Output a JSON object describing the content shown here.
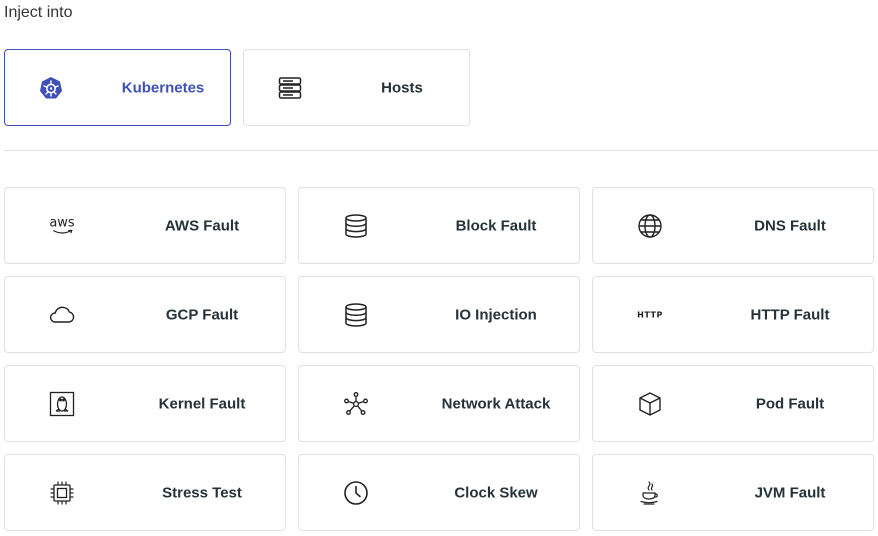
{
  "header": {
    "title": "Inject into"
  },
  "targets": [
    {
      "label": "Kubernetes",
      "icon": "kubernetes-icon",
      "selected": true
    },
    {
      "label": "Hosts",
      "icon": "server-icon",
      "selected": false
    }
  ],
  "faults": [
    {
      "label": "AWS Fault",
      "icon": "aws-icon",
      "icon_text": "aws"
    },
    {
      "label": "Block Fault",
      "icon": "database-icon"
    },
    {
      "label": "DNS Fault",
      "icon": "globe-icon"
    },
    {
      "label": "GCP Fault",
      "icon": "cloud-icon"
    },
    {
      "label": "IO Injection",
      "icon": "database-icon"
    },
    {
      "label": "HTTP Fault",
      "icon": "http-icon",
      "icon_text": "HTTP"
    },
    {
      "label": "Kernel Fault",
      "icon": "linux-icon"
    },
    {
      "label": "Network Attack",
      "icon": "network-icon"
    },
    {
      "label": "Pod Fault",
      "icon": "cube-icon"
    },
    {
      "label": "Stress Test",
      "icon": "cpu-icon"
    },
    {
      "label": "Clock Skew",
      "icon": "clock-icon"
    },
    {
      "label": "JVM Fault",
      "icon": "java-icon"
    }
  ],
  "colors": {
    "selected_accent": "#3f51b5",
    "border": "#e0e0e0"
  }
}
